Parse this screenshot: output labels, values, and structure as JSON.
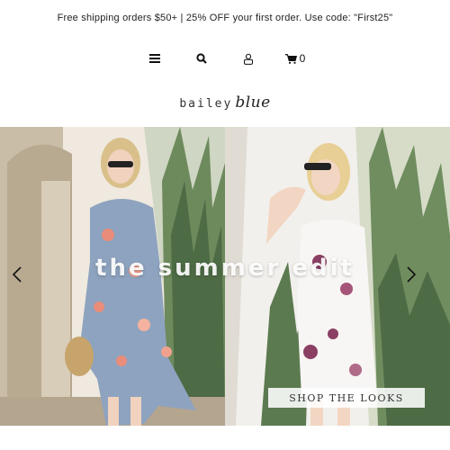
{
  "announcement": {
    "text": "Free shipping orders $50+ | 25% OFF your first order. Use code: \"First25\""
  },
  "header": {
    "icons": [
      "menu-icon",
      "search-icon",
      "account-icon",
      "cart-icon"
    ],
    "cart_count": "0"
  },
  "logo": {
    "part1": "bailey",
    "part2": "blue"
  },
  "hero": {
    "title": "the summer edit",
    "button_label": "SHOP THE LOOKS",
    "prev_icon": "chevron-left-icon",
    "next_icon": "chevron-right-icon"
  }
}
